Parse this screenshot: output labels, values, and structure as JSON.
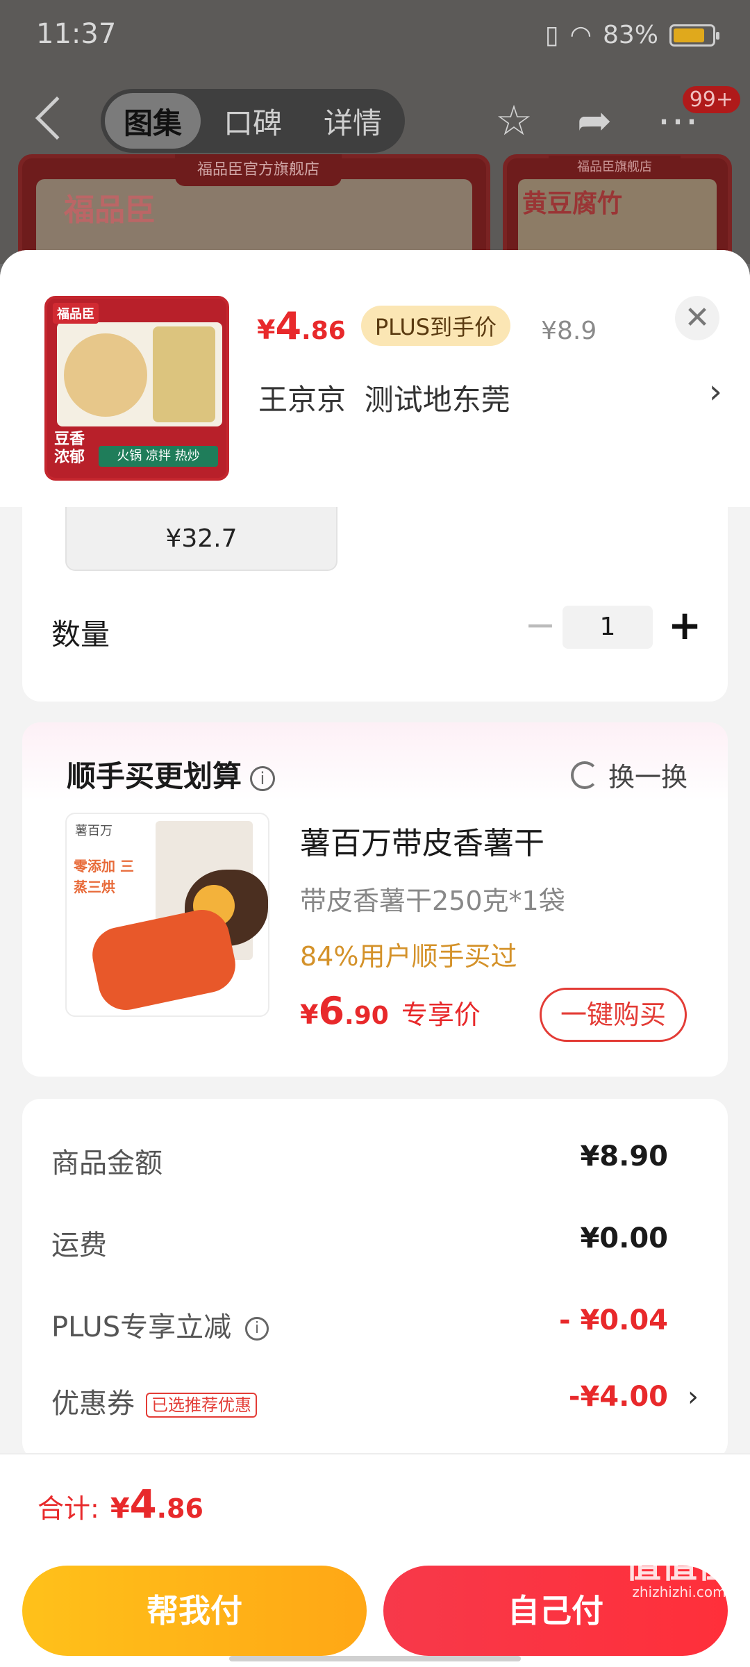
{
  "status": {
    "time": "11:37",
    "battery": "83%"
  },
  "nav": {
    "tabs": [
      "图集",
      "口碑",
      "详情"
    ],
    "badge": "99+"
  },
  "bg": {
    "shop_name": "福品臣官方旗舰店",
    "logo_text": "福品臣",
    "banner2_shop": "福品臣旗舰店",
    "banner2_title": "黄豆腐竹"
  },
  "product": {
    "price_currency": "¥",
    "price_int": "4",
    "price_dec": ".86",
    "plus_label": "PLUS到手价",
    "original_price": "¥8.9",
    "address": "王京京  测试地东莞",
    "thumb_logo": "福品臣",
    "thumb_tag": "豆香浓郁",
    "thumb_badge": "火锅 凉拌 热炒"
  },
  "spec": {
    "price": "¥32.7"
  },
  "quantity": {
    "label": "数量",
    "value": "1",
    "minus": "−",
    "plus": "+"
  },
  "addon": {
    "title": "顺手买更划算",
    "refresh_label": "换一换",
    "name": "薯百万带皮香薯干",
    "spec": "带皮香薯干250克*1袋",
    "bought": "84%用户顺手买过",
    "price_currency": "¥",
    "price_int": "6",
    "price_dec": ".90",
    "price_label": "专享价",
    "buy_label": "一键购买",
    "img_brand": "薯百万",
    "img_text": "零添加 三蒸三烘"
  },
  "summary": {
    "rows": [
      {
        "label": "商品金额",
        "value": "¥8.90"
      },
      {
        "label": "运费",
        "value": "¥0.00"
      },
      {
        "label": "PLUS专享立减",
        "value": "- ¥0.04"
      },
      {
        "label": "优惠券",
        "tag": "已选推荐优惠",
        "value": "-¥4.00"
      }
    ]
  },
  "footer": {
    "total_label": "合计:",
    "total_currency": "¥",
    "total_int": "4",
    "total_dec": ".86",
    "help_pay": "帮我付",
    "self_pay": "自己付"
  },
  "watermark": {
    "main": "值值值",
    "sub": "zhizhizhi.com"
  },
  "colors": {
    "accent_red": "#e8292b",
    "plus_gold": "#fbe6b4",
    "help_btn": "#ffb718",
    "self_btn": "#f7394a"
  }
}
